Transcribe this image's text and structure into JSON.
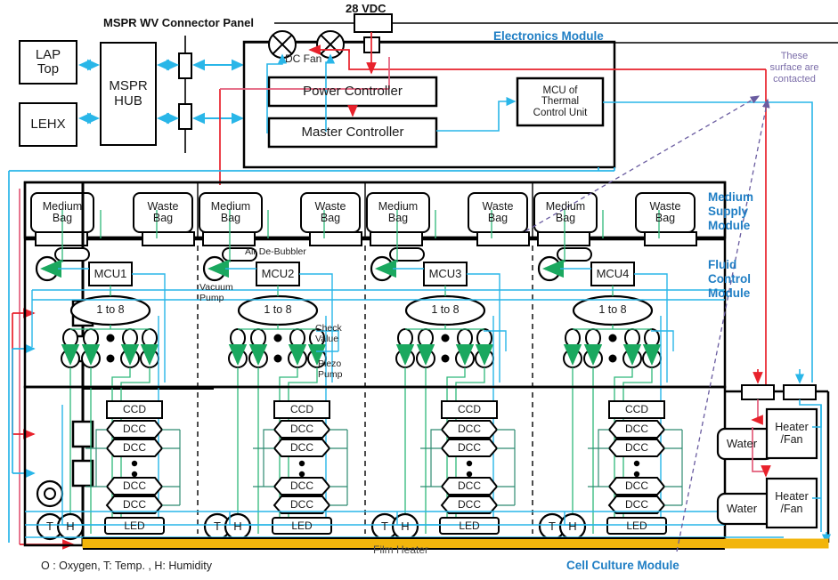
{
  "diagram": {
    "title_headers": {
      "connector_panel": "MSPR WV  Connector  Panel",
      "vdc": "28 VDC"
    },
    "module_labels": {
      "electronics": "Electronics Module",
      "medium_supply": "Medium\nSupply\nModule",
      "medium_supply_l1": "Medium",
      "medium_supply_l2": "Supply",
      "medium_supply_l3": "Module",
      "fluid_control_l1": "Fluid",
      "fluid_control_l2": "Control",
      "fluid_control_l3": "Module",
      "cell_culture": "Cell Culture Module"
    },
    "left_boxes": [
      {
        "label": "LAP\nTop",
        "l1": "LAP",
        "l2": "Top"
      },
      {
        "label": "LEHX",
        "l1": "LEHX",
        "l2": ""
      }
    ],
    "hub": {
      "l1": "MSPR",
      "l2": "HUB"
    },
    "electronics": {
      "power_controller": "Power Controller",
      "master_controller": "Master Controller",
      "mcu_thermal_l1": "MCU of",
      "mcu_thermal_l2": "Thermal",
      "mcu_thermal_l3": "Control Unit",
      "dc_fan": "DC Fan"
    },
    "annotations": {
      "these_surface_l1": "These",
      "these_surface_l2": "surface are",
      "these_surface_l3": "contacted",
      "air_debubbler": "Air De-Bubbler",
      "vacuum_pump_l1": "Vacuum",
      "vacuum_pump_l2": "Pump",
      "check_valve_l1": "Check",
      "check_valve_l2": "Value",
      "piezo_pump_l1": "Piezo",
      "piezo_pump_l2": "Pump",
      "film_heater": "Film Heater",
      "legend": "O : Oxygen, T: Temp. , H: Humidity"
    },
    "bags": [
      {
        "type": "medium",
        "l1": "Medium",
        "l2": "Bag"
      },
      {
        "type": "waste",
        "l1": "Waste",
        "l2": "Bag"
      },
      {
        "type": "medium",
        "l1": "Medium",
        "l2": "Bag"
      },
      {
        "type": "waste",
        "l1": "Waste",
        "l2": "Bag"
      },
      {
        "type": "medium",
        "l1": "Medium",
        "l2": "Bag"
      },
      {
        "type": "waste",
        "l1": "Waste",
        "l2": "Bag"
      },
      {
        "type": "medium",
        "l1": "Medium",
        "l2": "Bag"
      },
      {
        "type": "waste",
        "l1": "Waste",
        "l2": "Bag"
      }
    ],
    "units": [
      {
        "mcu": "MCU1",
        "demux": "1 to 8",
        "ccd": "CCD",
        "dcc": [
          "DCC",
          "DCC",
          "DCC",
          "DCC"
        ],
        "led": "LED",
        "t": "T",
        "h": "H"
      },
      {
        "mcu": "MCU2",
        "demux": "1 to 8",
        "ccd": "CCD",
        "dcc": [
          "DCC",
          "DCC",
          "DCC",
          "DCC"
        ],
        "led": "LED",
        "t": "T",
        "h": "H"
      },
      {
        "mcu": "MCU3",
        "demux": "1 to 8",
        "ccd": "CCD",
        "dcc": [
          "DCC",
          "DCC",
          "DCC",
          "DCC"
        ],
        "led": "LED",
        "t": "T",
        "h": "H"
      },
      {
        "mcu": "MCU4",
        "demux": "1 to 8",
        "ccd": "CCD",
        "dcc": [
          "DCC",
          "DCC",
          "DCC",
          "DCC"
        ],
        "led": "LED",
        "t": "T",
        "h": "H"
      }
    ],
    "oxygen_sensor": "O",
    "thermal": {
      "water_1": "Water",
      "heater_fan_1_l1": "Heater",
      "heater_fan_1_l2": "/Fan",
      "water_2": "Water",
      "heater_fan_2_l1": "Heater",
      "heater_fan_2_l2": "/Fan"
    },
    "colors": {
      "module_label": "#1f7ec4",
      "data_line": "#29b6e8",
      "power_line": "#e8212b",
      "fluid_line": "#2eb87a",
      "sensor_line": "#33b5c8",
      "film_heater": "#f2b50c",
      "annotation": "#7a6ca8",
      "outline": "#000000"
    }
  }
}
